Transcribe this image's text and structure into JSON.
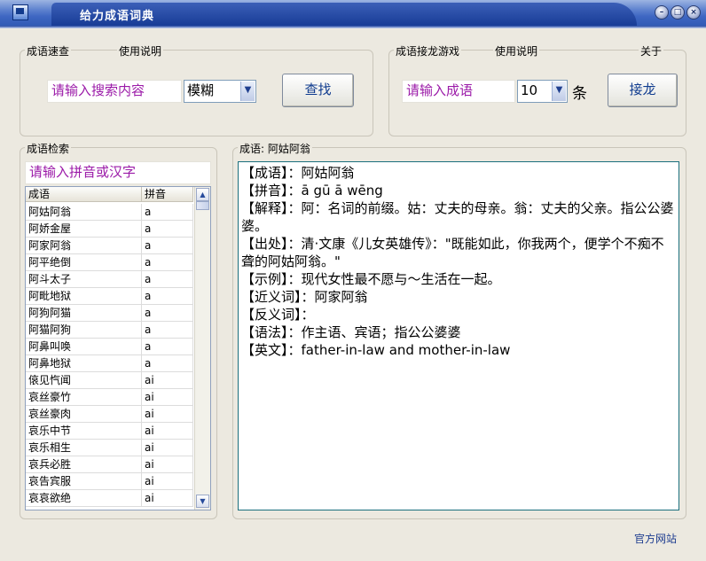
{
  "window": {
    "title": "给力成语词典"
  },
  "quick": {
    "group_label": "成语速查",
    "help_label": "使用说明",
    "search_placeholder": "请输入搜索内容",
    "mode_value": "模糊",
    "search_button": "查找"
  },
  "game": {
    "group_label": "成语接龙游戏",
    "help_label": "使用说明",
    "about_label": "关于",
    "input_placeholder": "请输入成语",
    "count_value": "10",
    "count_unit": "条",
    "play_button": "接龙"
  },
  "retrieval": {
    "group_label": "成语检索",
    "filter_placeholder": "请输入拼音或汉字",
    "columns": [
      "成语",
      "拼音"
    ],
    "rows": [
      [
        "阿姑阿翁",
        "a"
      ],
      [
        "阿娇金屋",
        "a"
      ],
      [
        "阿家阿翁",
        "a"
      ],
      [
        "阿平绝倒",
        "a"
      ],
      [
        "阿斗太子",
        "a"
      ],
      [
        "阿毗地狱",
        "a"
      ],
      [
        "阿狗阿猫",
        "a"
      ],
      [
        "阿猫阿狗",
        "a"
      ],
      [
        "阿鼻叫唤",
        "a"
      ],
      [
        "阿鼻地狱",
        "a"
      ],
      [
        "偯见忾闻",
        "ai"
      ],
      [
        "哀丝豪竹",
        "ai"
      ],
      [
        "哀丝豪肉",
        "ai"
      ],
      [
        "哀乐中节",
        "ai"
      ],
      [
        "哀乐相生",
        "ai"
      ],
      [
        "哀兵必胜",
        "ai"
      ],
      [
        "哀告宾服",
        "ai"
      ],
      [
        "哀哀欲绝",
        "ai"
      ]
    ]
  },
  "detail": {
    "group_label": "成语: 阿姑阿翁",
    "lines": [
      "【成语】：阿姑阿翁",
      "【拼音】：ā gū ā wēng",
      "【解释】：阿：名词的前缀。姑：丈夫的母亲。翁：丈夫的父亲。指公公婆婆。",
      "【出处】：清·文康《儿女英雄传》：\"既能如此，你我两个，便学个不痴不聋的阿姑阿翁。\"",
      "【示例】：现代女性最不愿与～生活在一起。",
      "【近义词】：阿家阿翁",
      "【反义词】：",
      "【语法】：作主语、宾语；指公公婆婆",
      "【英文】：father-in-law and mother-in-law"
    ]
  },
  "footer": {
    "official_site": "官方网站"
  },
  "icons": {
    "minimize": "minimize-icon",
    "restore": "restore-icon",
    "close": "close-icon"
  }
}
